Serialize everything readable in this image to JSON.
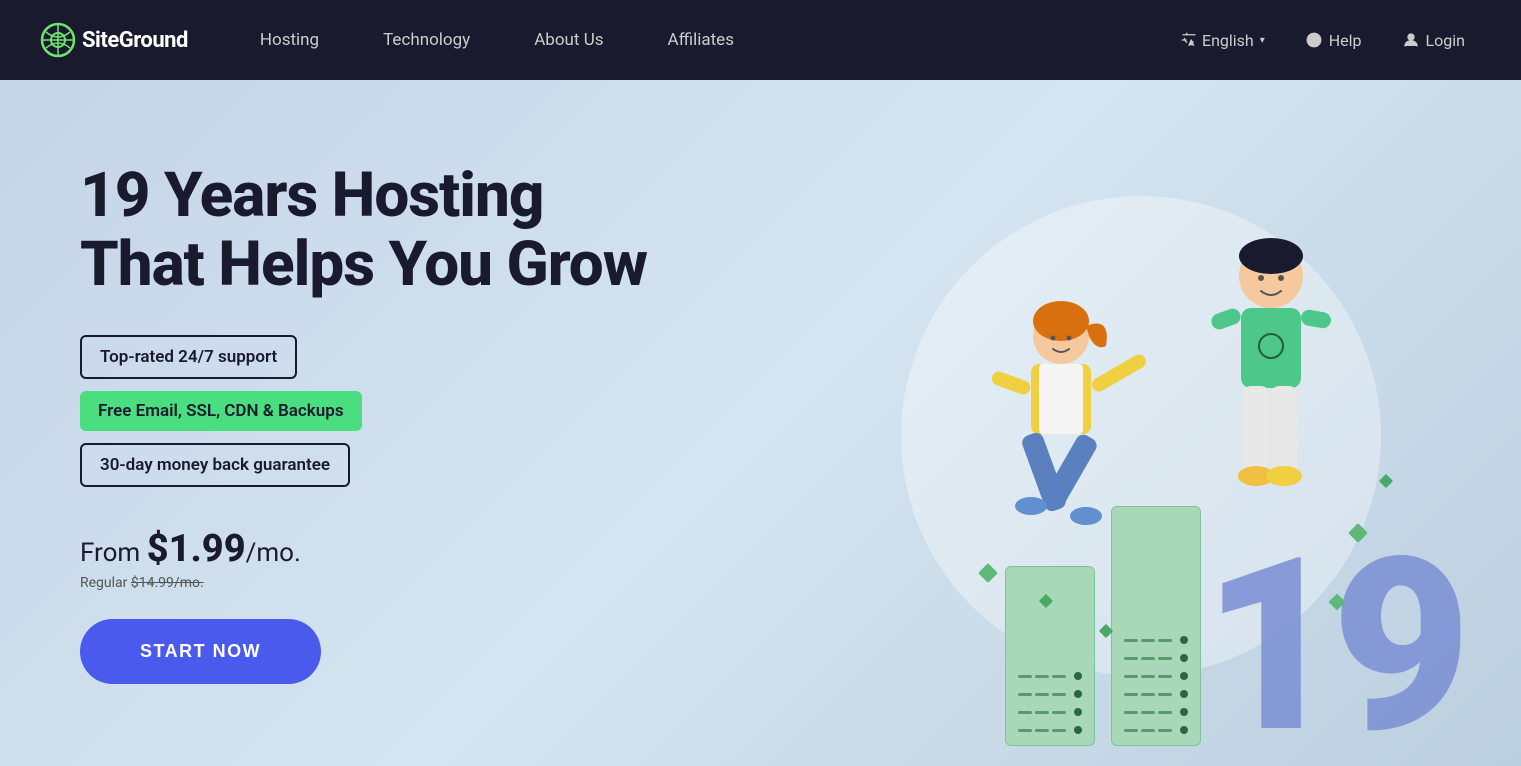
{
  "brand": {
    "name": "SiteGround",
    "logo_alt": "SiteGround Logo"
  },
  "nav": {
    "links": [
      {
        "id": "hosting",
        "label": "Hosting"
      },
      {
        "id": "technology",
        "label": "Technology"
      },
      {
        "id": "about",
        "label": "About Us"
      },
      {
        "id": "affiliates",
        "label": "Affiliates"
      }
    ],
    "right": {
      "language": "English",
      "help": "Help",
      "login": "Login"
    }
  },
  "hero": {
    "title_line1": "19 Years Hosting",
    "title_line2": "That Helps You Grow",
    "badges": [
      {
        "id": "support",
        "text": "Top-rated 24/7 support",
        "style": "outline"
      },
      {
        "id": "free",
        "text": "Free Email, SSL, CDN & Backups",
        "style": "green"
      },
      {
        "id": "money",
        "text": "30-day money back guarantee",
        "style": "outline"
      }
    ],
    "pricing": {
      "from_label": "From",
      "price": "$1.99",
      "period": "/mo.",
      "regular_label": "Regular",
      "regular_price": "$14.99/mo."
    },
    "cta_button": "START NOW"
  },
  "colors": {
    "background": "#c5d5e8",
    "nav_bg": "#1a1a2e",
    "accent_blue": "#4a5aed",
    "badge_green": "#4ade80",
    "number_color": "#7a8fd4",
    "server_color": "#a8d8b8"
  }
}
